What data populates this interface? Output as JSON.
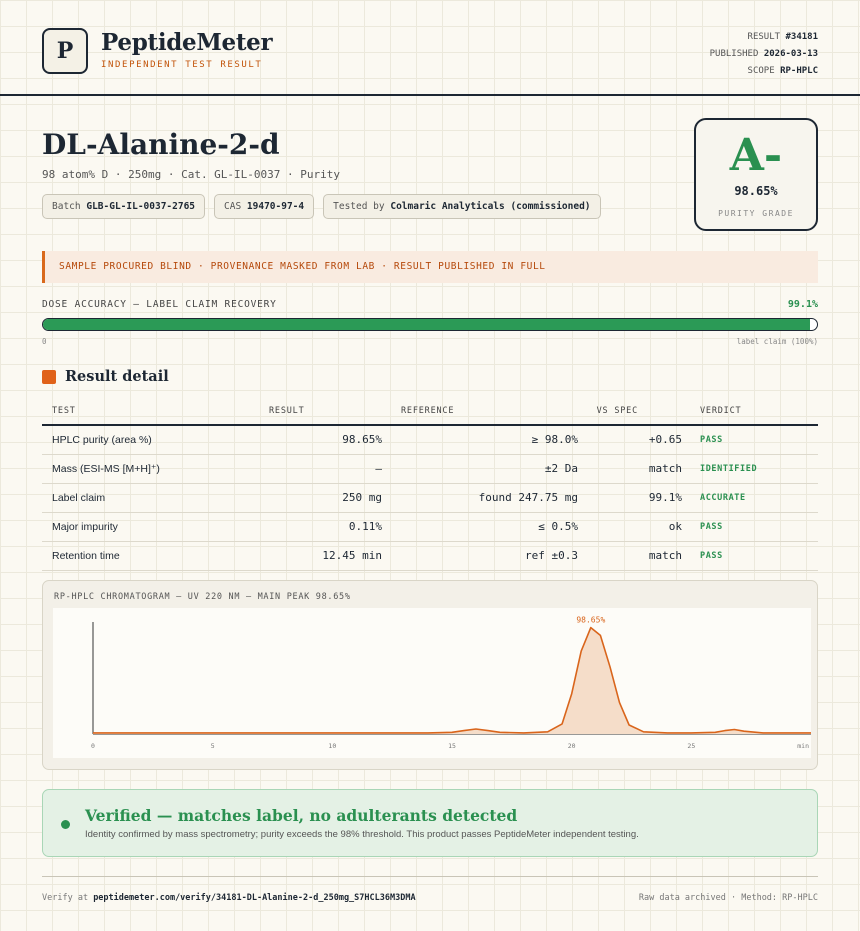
{
  "header": {
    "logo_letter": "P",
    "brand": "PeptideMeter",
    "tagline": "INDEPENDENT TEST RESULT",
    "result_label": "RESULT",
    "result_value": "#34181",
    "published_label": "PUBLISHED",
    "published_value": "2026-03-13",
    "scope_label": "SCOPE",
    "scope_value": "RP-HPLC"
  },
  "product": {
    "title": "DL-Alanine-2-d",
    "subtitle": "98 atom% D · 250mg · Cat. GL-IL-0037 · Purity",
    "batch_label": "Batch",
    "batch_value": "GLB-GL-IL-0037-2765",
    "cas_label": "CAS",
    "cas_value": "19470-97-4",
    "tested_label": "Tested by",
    "tested_value": "Colmaric Analyticals (commissioned)"
  },
  "grade": {
    "letter": "A-",
    "value": "98.65%",
    "label": "PURITY GRADE",
    "color": "#2a9050"
  },
  "notice": "SAMPLE PROCURED BLIND · PROVENANCE MASKED FROM LAB · RESULT PUBLISHED IN FULL",
  "dose": {
    "label": "DOSE ACCURACY — LABEL CLAIM RECOVERY",
    "value": "99.1%",
    "percent": 99.1,
    "zero_label": "0",
    "claim_label": "label claim (100%)"
  },
  "results": {
    "title": "Result detail",
    "columns": {
      "test": "TEST",
      "result": "RESULT",
      "reference": "REFERENCE",
      "vs_spec": "VS SPEC",
      "verdict": "VERDICT"
    },
    "rows": [
      {
        "test": "HPLC purity (area %)",
        "result": "98.65%",
        "reference": "≥ 98.0%",
        "vs_spec": "+0.65",
        "verdict": "PASS"
      },
      {
        "test": "Mass (ESI-MS [M+H]⁺)",
        "result": "—",
        "reference": "±2 Da",
        "vs_spec": "match",
        "verdict": "IDENTIFIED"
      },
      {
        "test": "Label claim",
        "result": "250 mg",
        "reference": "found 247.75 mg",
        "vs_spec": "99.1%",
        "verdict": "ACCURATE"
      },
      {
        "test": "Major impurity",
        "result": "0.11%",
        "reference": "≤ 0.5%",
        "vs_spec": "ok",
        "verdict": "PASS"
      },
      {
        "test": "Retention time",
        "result": "12.45 min",
        "reference": "ref ±0.3",
        "vs_spec": "match",
        "verdict": "PASS"
      }
    ]
  },
  "chart_data": {
    "type": "line",
    "title": "RP-HPLC CHROMATOGRAM — UV 220 NM — MAIN PEAK 98.65%",
    "xlabel": "",
    "ylabel": "",
    "x_ticks": [
      0,
      5,
      10,
      15,
      20,
      25
    ],
    "x_unit_label": "min",
    "xlim": [
      0,
      30
    ],
    "ylim": [
      0,
      100
    ],
    "peak_label": "98.65%",
    "line_color": "#d9651c",
    "fill_color": "#f5ddc9",
    "x": [
      0,
      2,
      4,
      6,
      8,
      10,
      12,
      14,
      15,
      15.5,
      16,
      16.5,
      17,
      18,
      19,
      19.6,
      20,
      20.4,
      20.8,
      21.2,
      21.6,
      22,
      22.4,
      23,
      24,
      25,
      26,
      26.4,
      26.8,
      27.2,
      28,
      29,
      30
    ],
    "y": [
      1,
      1,
      1,
      1,
      1,
      1,
      1,
      1,
      1.5,
      3,
      4.5,
      3,
      1.5,
      1,
      2,
      9,
      36,
      74,
      95,
      88,
      60,
      28,
      8,
      2,
      1,
      1,
      1.5,
      3,
      4,
      2.5,
      1,
      1,
      1
    ]
  },
  "verified": {
    "title": "Verified — matches label, no adulterants detected",
    "subtitle": "Identity confirmed by mass spectrometry; purity exceeds the 98% threshold. This product passes PeptideMeter independent testing."
  },
  "footer": {
    "verify_prefix": "Verify at",
    "verify_url": "peptidemeter.com/verify/34181-DL-Alanine-2-d_250mg_S7HCL36M3DMA",
    "right": "Raw data archived · Method: RP-HPLC"
  }
}
